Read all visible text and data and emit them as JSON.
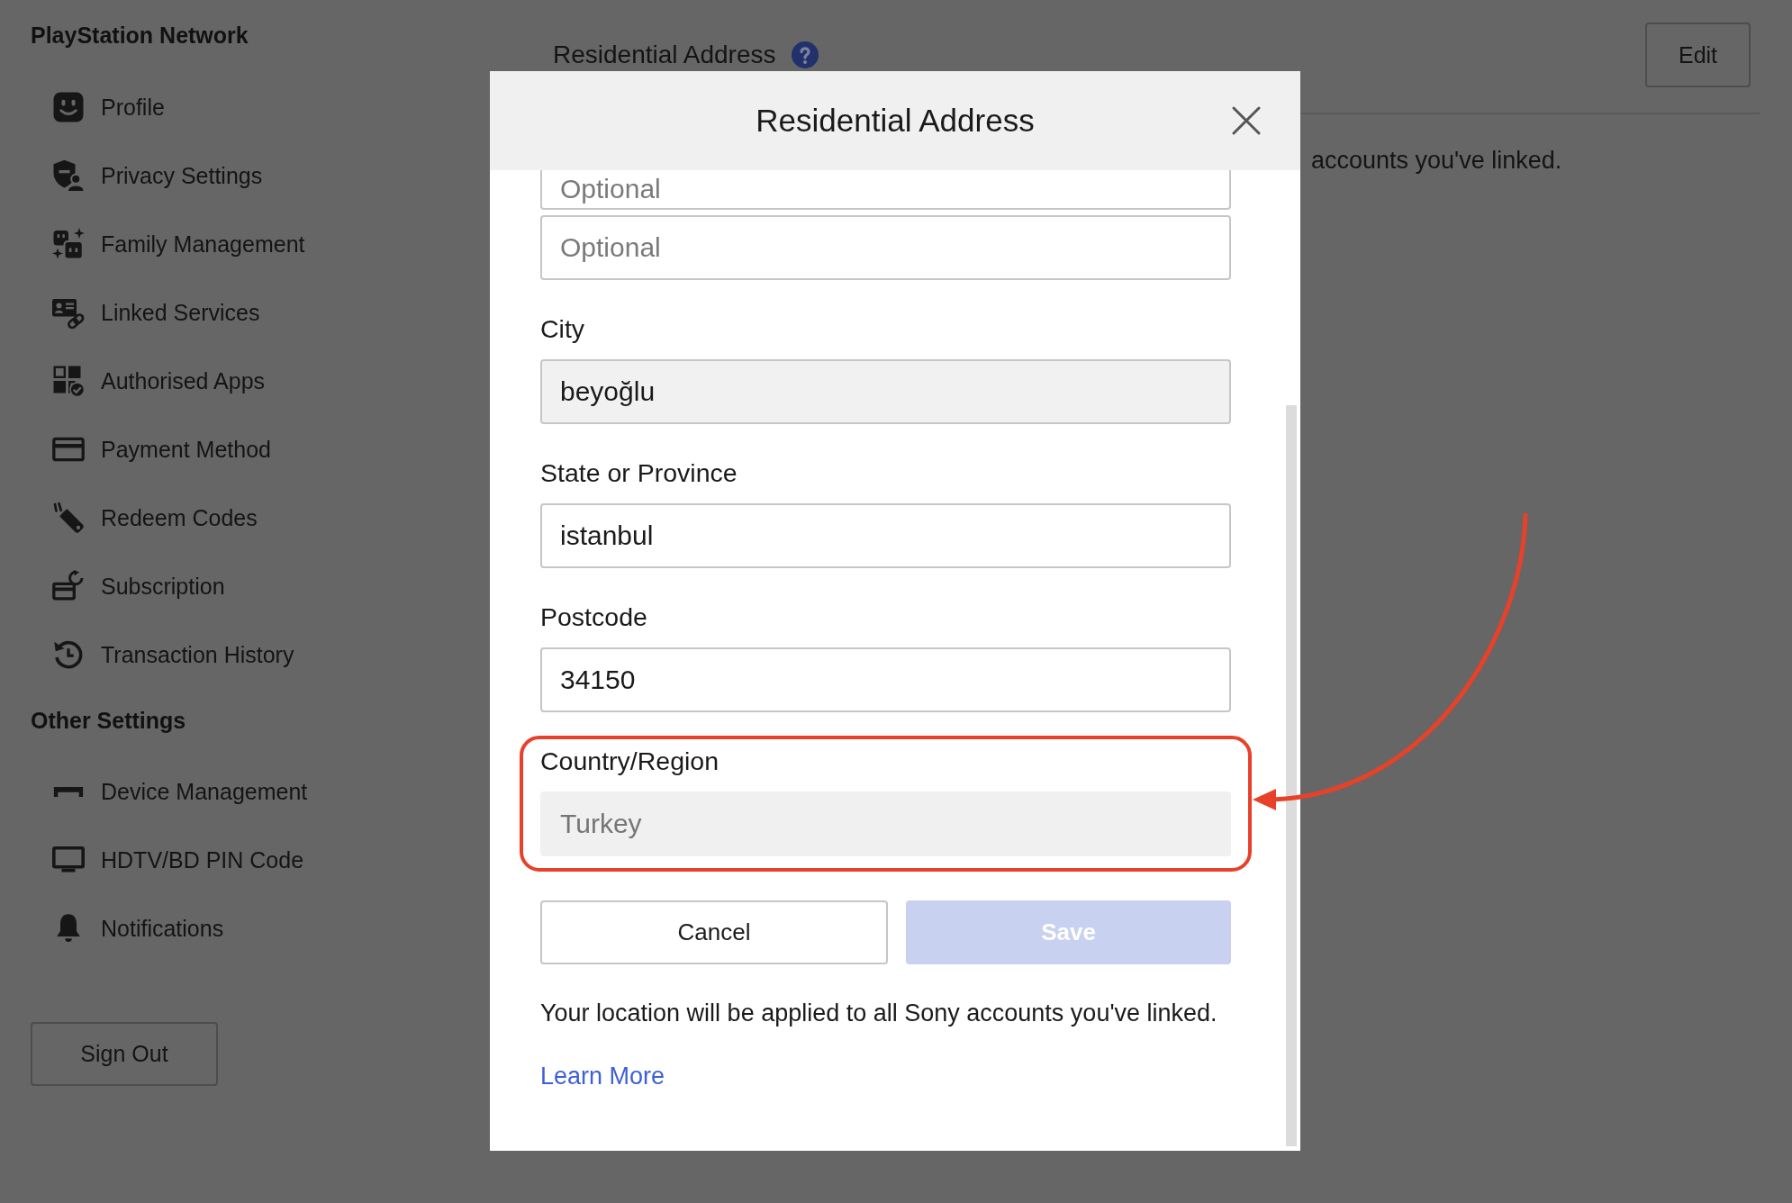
{
  "sidebar": {
    "sections": [
      {
        "title": "PlayStation Network",
        "items": [
          {
            "label": "Profile"
          },
          {
            "label": "Privacy Settings"
          },
          {
            "label": "Family Management"
          },
          {
            "label": "Linked Services"
          },
          {
            "label": "Authorised Apps"
          },
          {
            "label": "Payment Method"
          },
          {
            "label": "Redeem Codes"
          },
          {
            "label": "Subscription"
          },
          {
            "label": "Transaction History"
          }
        ]
      },
      {
        "title": "Other Settings",
        "items": [
          {
            "label": "Device Management"
          },
          {
            "label": "HDTV/BD PIN Code"
          },
          {
            "label": "Notifications"
          }
        ]
      }
    ],
    "sign_out_button": "Sign Out"
  },
  "main": {
    "heading": "Residential Address",
    "edit_button": "Edit",
    "description_fragment": "accounts you've linked."
  },
  "modal": {
    "title": "Residential Address",
    "fields": [
      {
        "placeholder": "Optional",
        "clipped": true,
        "hovered": false,
        "disabled": false,
        "highlighted": false
      },
      {
        "placeholder": "Optional",
        "clipped": false,
        "hovered": false,
        "disabled": false,
        "highlighted": false
      },
      {
        "label": "City",
        "value": "beyoğlu",
        "clipped": false,
        "hovered": true,
        "disabled": false,
        "highlighted": false
      },
      {
        "label": "State or Province",
        "value": "istanbul",
        "clipped": false,
        "hovered": false,
        "disabled": false,
        "highlighted": false
      },
      {
        "label": "Postcode",
        "value": "34150",
        "clipped": false,
        "hovered": false,
        "disabled": false,
        "highlighted": false
      },
      {
        "label": "Country/Region",
        "value": "Turkey",
        "clipped": false,
        "hovered": false,
        "disabled": true,
        "highlighted": true
      }
    ],
    "buttons": [
      {
        "label": "Cancel",
        "kind": "secondary",
        "disabled": false
      },
      {
        "label": "Save",
        "kind": "primary",
        "disabled": true
      }
    ],
    "note": "Your location will be applied to all Sony accounts you've linked.",
    "link": "Learn More"
  },
  "annotation_arrow": true
}
